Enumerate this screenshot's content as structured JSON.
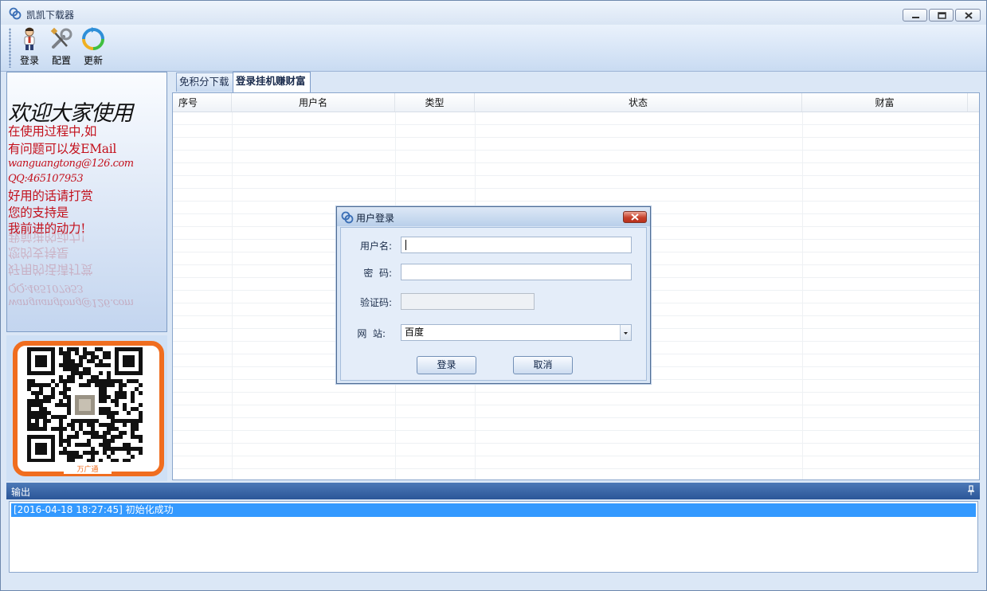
{
  "window": {
    "title": "凯凯下载器"
  },
  "toolbar": {
    "login_label": "登录",
    "config_label": "配置",
    "update_label": "更新"
  },
  "welcome": {
    "title": "欢迎大家使用",
    "lines": [
      "在使用过程中,如",
      "有问题可以发EMail",
      "wanguangtong@126.com",
      "QQ:465107953",
      "好用的话请打赏",
      "您的支持是",
      "我前进的动力!"
    ]
  },
  "qr": {
    "caption": "万广通"
  },
  "tabs": [
    {
      "label": "免积分下载"
    },
    {
      "label": "登录挂机赚财富"
    }
  ],
  "grid": {
    "columns": [
      "序号",
      "用户名",
      "类型",
      "状态",
      "财富"
    ]
  },
  "dialog": {
    "title": "用户登录",
    "username_label": "用户名:",
    "password_label": "密  码:",
    "captcha_label": "验证码:",
    "site_label": "网  站:",
    "site_value": "百度",
    "ok_label": "登录",
    "cancel_label": "取消"
  },
  "output": {
    "title": "输出",
    "log": [
      "[2016-04-18 18:27:45] 初始化成功"
    ]
  },
  "colors": {
    "accent": "#3399ff",
    "welcome_text": "#c3111d",
    "qr_frame": "#f06d1f",
    "output_header": "#2b5698"
  }
}
